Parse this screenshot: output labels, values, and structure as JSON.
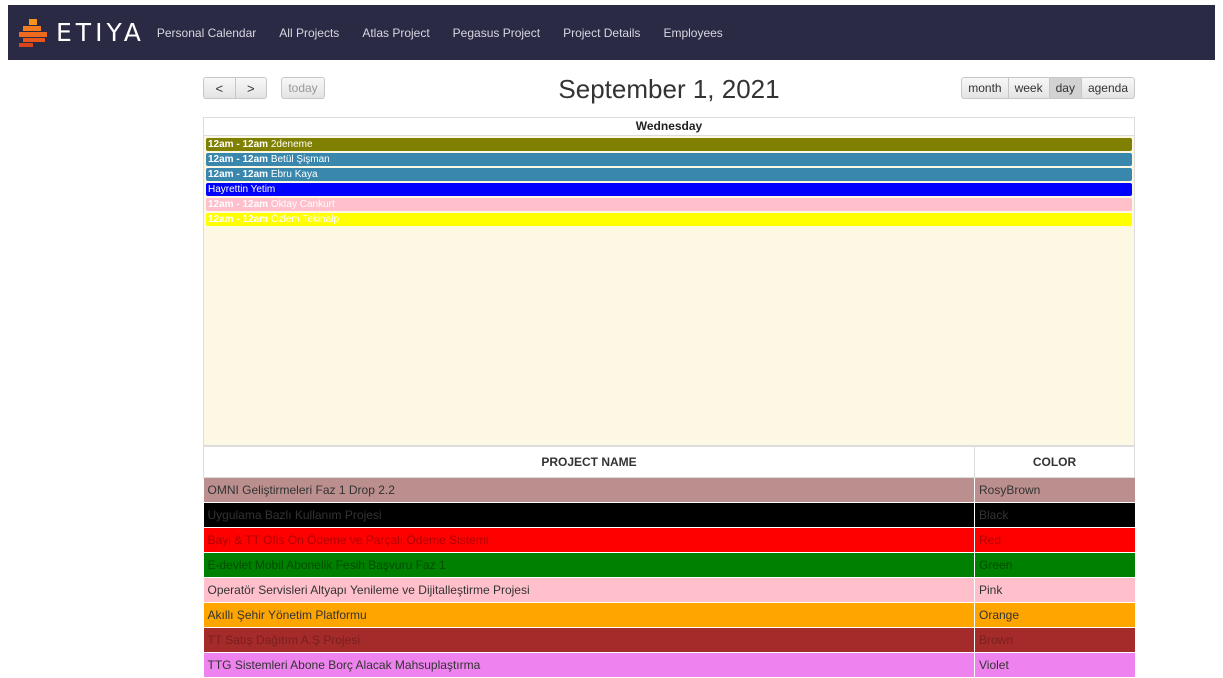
{
  "brand": {
    "name": "ETIYA"
  },
  "nav": {
    "items": [
      "Personal Calendar",
      "All Projects",
      "Atlas Project",
      "Pegasus Project",
      "Project Details",
      "Employees"
    ]
  },
  "toolbar": {
    "prev": "<",
    "next": ">",
    "today": "today",
    "title": "September 1, 2021",
    "views": [
      {
        "label": "month",
        "active": false
      },
      {
        "label": "week",
        "active": false
      },
      {
        "label": "day",
        "active": true
      },
      {
        "label": "agenda",
        "active": false
      }
    ]
  },
  "calendar": {
    "day_header": "Wednesday",
    "events": [
      {
        "time": "12am - 12am",
        "title": "2deneme",
        "bg": "#808000",
        "fg": "#ffffff"
      },
      {
        "time": "12am - 12am",
        "title": "Betül Şişman",
        "bg": "#3a87ad",
        "fg": "#ffffff"
      },
      {
        "time": "12am - 12am",
        "title": "Ebru Kaya",
        "bg": "#3a87ad",
        "fg": "#ffffff"
      },
      {
        "time": "",
        "title": "Hayrettin Yetim",
        "bg": "#0000ff",
        "fg": "#ffffff"
      },
      {
        "time": "12am - 12am",
        "title": "Oktay Cankurt",
        "bg": "#ffc0cb",
        "fg": "#ffffff"
      },
      {
        "time": "12am - 12am",
        "title": "Özlem Tekinalp",
        "bg": "#ffff00",
        "fg": "#ffffff"
      }
    ]
  },
  "projects": {
    "headers": {
      "name": "PROJECT NAME",
      "color": "COLOR"
    },
    "rows": [
      {
        "name": "OMNI Geliştirmeleri Faz 1 Drop 2.2",
        "color": "RosyBrown",
        "bg": "#bc8f8f",
        "fg": "#333333"
      },
      {
        "name": "Uygulama Bazlı Kullanım Projesi",
        "color": "Black",
        "bg": "#000000",
        "fg": "#333333"
      },
      {
        "name": "Bayi & TT Ofis Ön Ödeme ve Parçalı Ödeme Sistemi",
        "color": "Red",
        "bg": "#ff0000",
        "fg": "#b30000"
      },
      {
        "name": "E-devlet Mobil Abonelik Fesih Başvuru Faz 1",
        "color": "Green",
        "bg": "#008000",
        "fg": "#004d00"
      },
      {
        "name": "Operatör Servisleri Altyapı Yenileme ve Dijitalleştirme Projesi",
        "color": "Pink",
        "bg": "#ffc0cb",
        "fg": "#333333"
      },
      {
        "name": "Akıllı Şehir Yönetim Platformu",
        "color": "Orange",
        "bg": "#ffa500",
        "fg": "#333333"
      },
      {
        "name": "TT Satış Dağıtım A.Ş Projesi",
        "color": "Brown",
        "bg": "#a52a2a",
        "fg": "#7a1f1f"
      },
      {
        "name": "TTG Sistemleri Abone Borç Alacak Mahsuplaştırma",
        "color": "Violet",
        "bg": "#ee82ee",
        "fg": "#333333"
      }
    ]
  }
}
